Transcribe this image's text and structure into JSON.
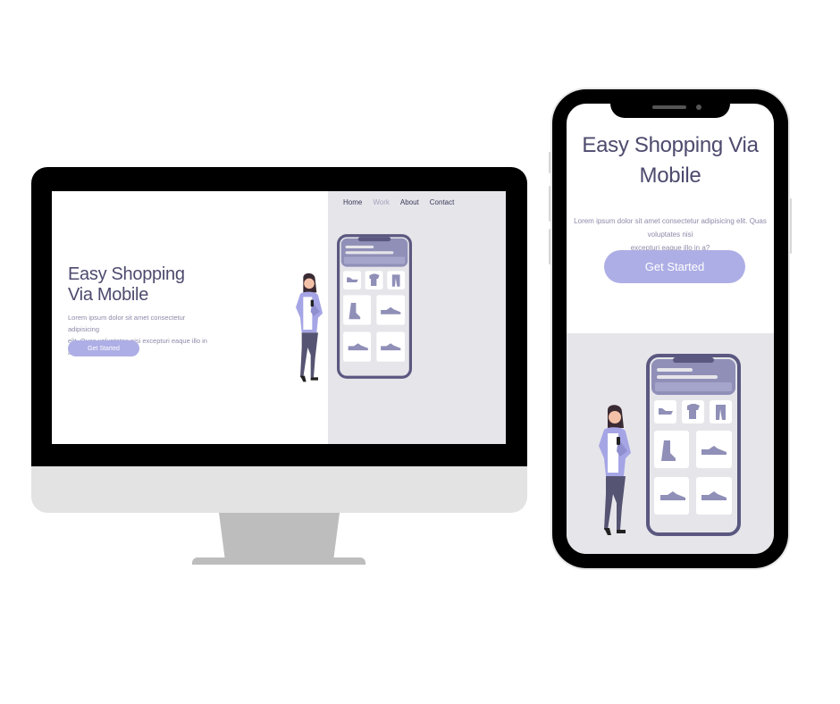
{
  "desktop": {
    "nav": [
      {
        "label": "Home",
        "active": false
      },
      {
        "label": "Work",
        "active": true
      },
      {
        "label": "About",
        "active": false
      },
      {
        "label": "Contact",
        "active": false
      }
    ],
    "hero_title_line1": "Easy Shopping",
    "hero_title_line2": "Via Mobile",
    "hero_desc_line1": "Lorem ipsum dolor sit amet consectetur adipisicing",
    "hero_desc_line2": "elit. Quas voluptates nisi excepturi eaque illo in a?",
    "cta_label": "Get Started"
  },
  "mobile": {
    "hero_title_line1": "Easy Shopping Via",
    "hero_title_line2": "Mobile",
    "hero_desc_line1": "Lorem ipsum dolor sit amet consectetur adipisicing elit. Quas voluptates nisi",
    "hero_desc_line2": "excepturi eaque illo in a?",
    "cta_label": "Get Started"
  },
  "illustration": {
    "products": [
      "shoe-icon",
      "tshirt-icon",
      "pants-icon",
      "boot-icon",
      "sneaker-icon",
      "sneaker-icon",
      "sneaker-icon"
    ]
  },
  "colors": {
    "accent": "#aeaee6",
    "title": "#4d4a6e",
    "panel": "#e6e5ea",
    "phone_frame": "#5a5880"
  }
}
